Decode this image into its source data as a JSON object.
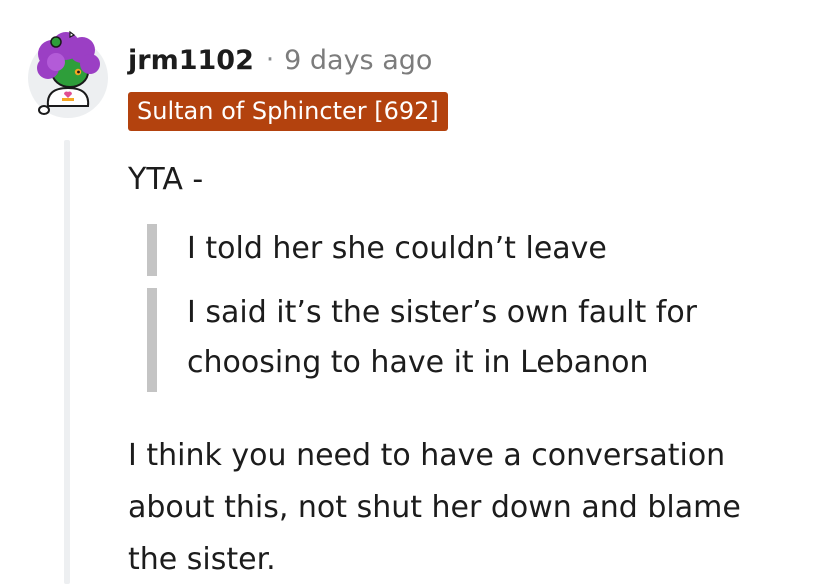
{
  "comment": {
    "author": "jrm1102",
    "separator": "·",
    "timestamp": "9 days ago",
    "flair": "Sultan of Sphincter [692]",
    "opening": "YTA -",
    "quotes": [
      {
        "lines": [
          "I told her she couldn’t leave"
        ]
      },
      {
        "lines": [
          "I said it’s the sister’s own fault for",
          "choosing to have it in Lebanon"
        ]
      }
    ],
    "body_lines": [
      "I think you need to have a conversation",
      "about this, not shut her down and blame",
      "the sister."
    ]
  },
  "avatar": {
    "icon": "snoo-avatar-icon",
    "hair_color": "#9b3fc4",
    "skin_color": "#2e9e3a",
    "accent_color": "#f5a623"
  },
  "colors": {
    "flair_background": "#b3420e",
    "flair_text": "#ffffff",
    "thread_line": "#edeff1",
    "quote_bar": "#c4c4c4"
  }
}
